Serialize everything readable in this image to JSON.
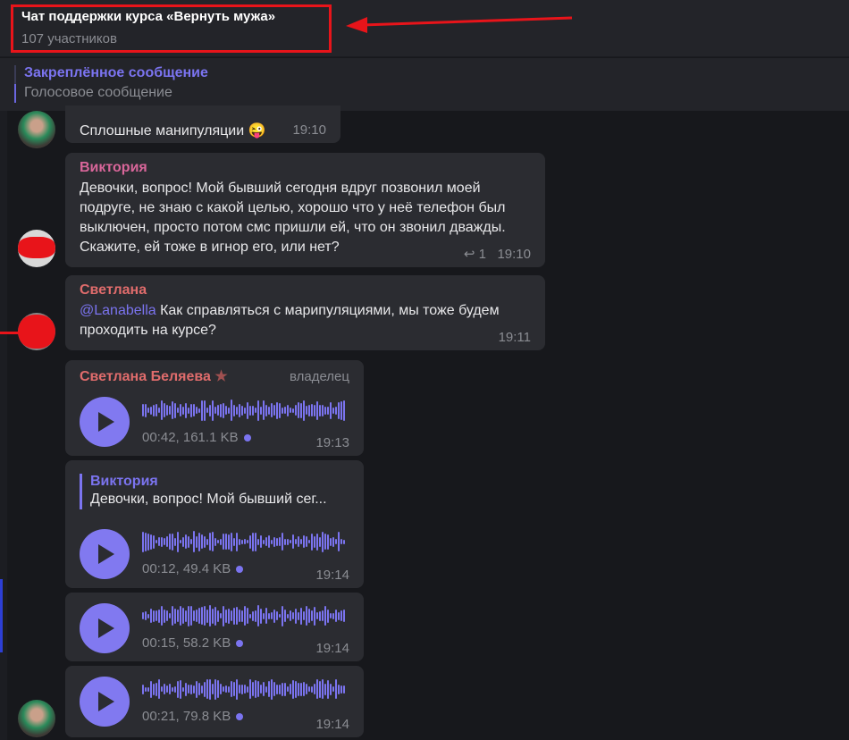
{
  "header": {
    "title": "Чат поддержки курса «Вернуть мужа»",
    "subtitle": "107 участников"
  },
  "pinned": {
    "title": "Закреплённое сообщение",
    "text": "Голосовое сообщение"
  },
  "colors": {
    "accent": "#7b74f0",
    "annotation": "#e8141a",
    "name_viktoria": "#d9669a",
    "name_svetlana": "#e06c6c"
  },
  "messages": [
    {
      "text": "Сплошные манипуляции",
      "emoji": "😜",
      "time": "19:10"
    },
    {
      "author": "Виктория",
      "text": "Девочки,  вопрос! Мой бывший сегодня вдруг позвонил моей подруге, не знаю с какой целью, хорошо что у неё телефон был выключен, просто потом смс пришли ей, что он звонил дважды. Скажите,  ей тоже в  игнор его, или нет?",
      "replies": "1",
      "time": "19:10"
    },
    {
      "author": "Светлана",
      "mention": "@Lanabella",
      "text": " Как справляться с марипуляциями, мы тоже будем проходить на курсе?",
      "time": "19:11"
    },
    {
      "author": "Светлана Беляева",
      "badge": "владелец",
      "meta": "00:42, 161.1 KB",
      "time": "19:13"
    },
    {
      "reply_author": "Виктория",
      "reply_text": "Девочки,  вопрос! Мой бывший сег...",
      "meta": "00:12, 49.4 KB",
      "time": "19:14"
    },
    {
      "meta": "00:15, 58.2 KB",
      "time": "19:14"
    },
    {
      "meta": "00:21, 79.8 KB",
      "time": "19:14"
    }
  ]
}
